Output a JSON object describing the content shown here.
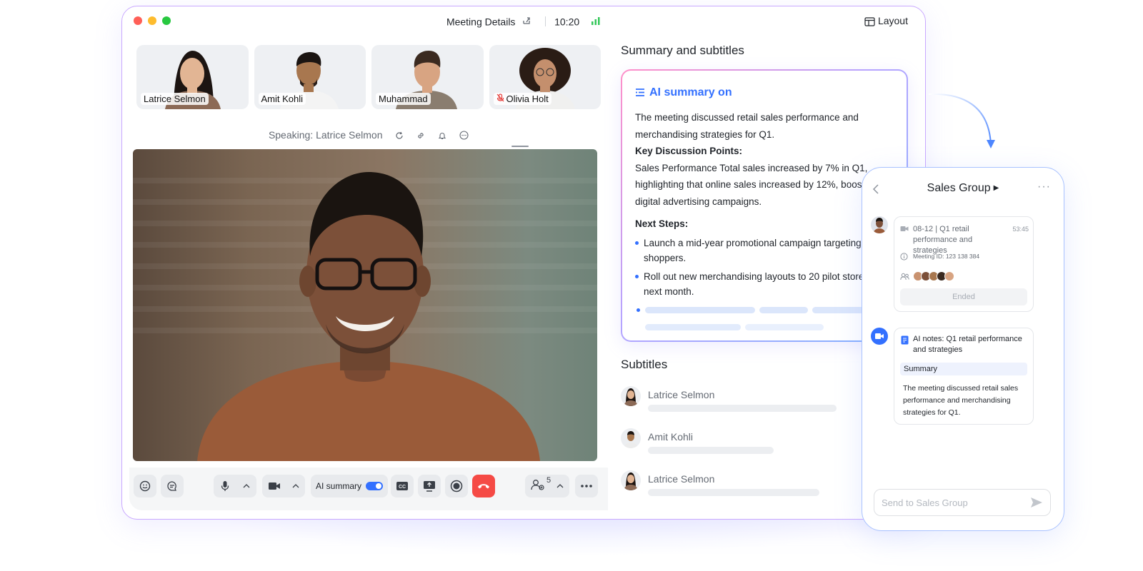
{
  "window": {
    "title": "Meeting Details",
    "time": "10:20",
    "layout_label": "Layout",
    "traffic_lights": [
      "#ff5f57",
      "#febc2e",
      "#28c840"
    ]
  },
  "participants": [
    {
      "name": "Latrice Selmon",
      "muted": false
    },
    {
      "name": "Amit Kohli",
      "muted": false
    },
    {
      "name": "Muhammad",
      "muted": false
    },
    {
      "name": "Olivia Holt",
      "muted": true
    }
  ],
  "speaking": "Speaking: Latrice Selmon",
  "controls": {
    "ai_summary_label": "AI summary",
    "ai_summary_on": true,
    "participant_count": "5"
  },
  "panel": {
    "title": "Summary and subtitles",
    "ai_heading": "AI summary on",
    "intro": "The meeting discussed retail sales performance and merchandising strategies for Q1.",
    "key_points_heading": "Key Discussion Points:",
    "key_points_text": "Sales Performance Total sales increased by 7% in Q1, highlighting that online sales increased by 12%, boosted by digital advertising campaigns.",
    "next_steps_heading": "Next Steps:",
    "next_steps": [
      "Launch a mid-year promotional campaign targeting online shoppers.",
      "Roll out new merchandising layouts to 20 pilot stores by next month."
    ]
  },
  "subtitles": {
    "title": "Subtitles",
    "rows": [
      {
        "speaker": "Latrice Selmon"
      },
      {
        "speaker": "Amit Kohli"
      },
      {
        "speaker": "Latrice Selmon"
      }
    ]
  },
  "phone": {
    "title": "Sales Group",
    "meeting_card": {
      "title": "08-12 | Q1 retail performance and strategies",
      "time": "53:45",
      "meeting_id": "Meeting ID: 123 138 384",
      "status": "Ended"
    },
    "notes_card": {
      "title": "AI notes: Q1 retail performance and strategies",
      "section": "Summary",
      "text": "The meeting discussed retail sales performance and merchandising strategies for Q1."
    },
    "input_placeholder": "Send to Sales Group"
  },
  "colors": {
    "accent": "#3370ff",
    "end_call": "#f54a45",
    "window_border": "#c9a8ff"
  }
}
